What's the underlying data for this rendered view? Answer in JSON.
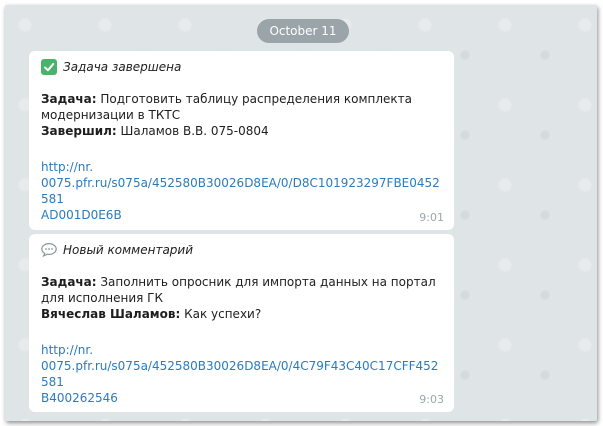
{
  "date_separator": "October 11",
  "messages": [
    {
      "icon": "check-icon",
      "header": "Задача завершена",
      "task_label": "Задача:",
      "task_line1": " Подготовить таблицу распределения комплекта",
      "task_line2": "модернизации в ТКТС",
      "second_label": "Завершил:",
      "second_value": " Шаламов В.В. 075-0804",
      "link_line1": "http://nr.",
      "link_line2": "0075.pfr.ru/s075a/452580B30026D8EA/0/D8C101923297FBE0452581",
      "link_line3": "AD001D0E6B",
      "time": "9:01"
    },
    {
      "icon": "speech-bubble-icon",
      "header": "Новый комментарий",
      "task_label": "Задача:",
      "task_line1": " Заполнить опросник для импорта данных на портал",
      "task_line2": "для исполнения ГК",
      "second_label": "Вячеслав Шаламов:",
      "second_value": " Как успехи?",
      "link_line1": "http://nr.",
      "link_line2": "0075.pfr.ru/s075a/452580B30026D8EA/0/4C79F43C40C17CFF452581",
      "link_line3": "B400262546",
      "time": "9:03"
    }
  ],
  "colors": {
    "chat_background": "#dfe4e6",
    "date_pill": "#9aa4a9",
    "link": "#2a7bbf",
    "check": "#47b36b",
    "timestamp": "#9ca6ab"
  }
}
